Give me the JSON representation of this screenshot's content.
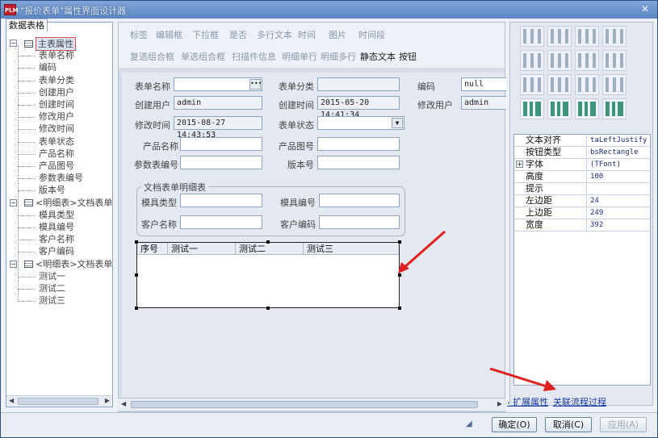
{
  "window": {
    "title": "\"报价表单\"属性界面设计器",
    "app_icon": "PLM"
  },
  "left": {
    "tab": "数据表格",
    "tree": [
      {
        "label": "主表属性",
        "level": 0,
        "expander": "−",
        "selected": true
      },
      {
        "label": "表单名称",
        "level": 1
      },
      {
        "label": "编码",
        "level": 1
      },
      {
        "label": "表单分类",
        "level": 1
      },
      {
        "label": "创建用户",
        "level": 1
      },
      {
        "label": "创建时间",
        "level": 1
      },
      {
        "label": "修改用户",
        "level": 1
      },
      {
        "label": "修改时间",
        "level": 1
      },
      {
        "label": "表单状态",
        "level": 1
      },
      {
        "label": "产品名称",
        "level": 1
      },
      {
        "label": "产品图号",
        "level": 1
      },
      {
        "label": "参数表编号",
        "level": 1
      },
      {
        "label": "版本号",
        "level": 1
      },
      {
        "label": "<明细表>文档表单明",
        "level": 0,
        "expander": "−"
      },
      {
        "label": "模具类型",
        "level": 1
      },
      {
        "label": "模具编号",
        "level": 1
      },
      {
        "label": "客户名称",
        "level": 1
      },
      {
        "label": "客户编码",
        "level": 1
      },
      {
        "label": "<明细表>文档表单多",
        "level": 0,
        "expander": "−"
      },
      {
        "label": "测试一",
        "level": 1
      },
      {
        "label": "测试二",
        "level": 1
      },
      {
        "label": "测试三",
        "level": 1
      }
    ]
  },
  "toolbar": {
    "row1": [
      "标签",
      "编辑框",
      "下拉框",
      "是否",
      "多行文本",
      "时间",
      "图片",
      "时间段"
    ],
    "row2": [
      "复选组合框",
      "单选组合框",
      "扫描件信息",
      "明细单行",
      "明细多行",
      "静态文本",
      "按钮"
    ]
  },
  "form": {
    "form_name_label": "表单名称",
    "form_name_value": "",
    "form_category_label": "表单分类",
    "form_category_value": "",
    "code_label": "编码",
    "code_value": "null",
    "creator_label": "创建用户",
    "creator_value": "admin",
    "created_label": "创建时间",
    "created_value": "2015-05-20 14:41:34",
    "modifier_label": "修改用户",
    "modifier_value": "admin",
    "modified_label": "修改时间",
    "modified_value": "2015-08-27 14:43:53",
    "status_label": "表单状态",
    "status_value": "",
    "product_name_label": "产品名称",
    "product_drawing_label": "产品图号",
    "param_no_label": "参数表编号",
    "version_label": "版本号",
    "group_title": "文档表单明细表",
    "mold_type_label": "模具类型",
    "mold_no_label": "模具编号",
    "customer_name_label": "客户名称",
    "customer_code_label": "客户编码",
    "grid_columns": [
      "序号",
      "测试一",
      "测试二",
      "测试三"
    ]
  },
  "properties": [
    {
      "key": "文本对齐",
      "value": "taLeftJustify"
    },
    {
      "key": "按钮类型",
      "value": "bsRectangle"
    },
    {
      "key": "字体",
      "value": "(TFont)",
      "expander": "+"
    },
    {
      "key": "高度",
      "value": "100"
    },
    {
      "key": "提示",
      "value": ""
    },
    {
      "key": "左边距",
      "value": "24"
    },
    {
      "key": "上边距",
      "value": "249"
    },
    {
      "key": "宽度",
      "value": "392"
    }
  ],
  "links": {
    "extended": "扩展属性",
    "workflow": "关联流程过程"
  },
  "buttons": {
    "ok": "确定(O)",
    "cancel": "取消(C)",
    "apply": "应用(A)"
  },
  "colors": {
    "accent": "#5d86c2",
    "arrow": "#e02020"
  }
}
